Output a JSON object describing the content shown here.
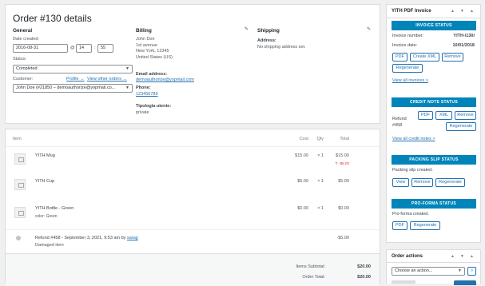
{
  "order": {
    "title": "Order #130 details",
    "general": {
      "heading": "General",
      "date_label": "Date created:",
      "date": "2016-08-31",
      "at": "@",
      "hour": "14",
      "colon": ":",
      "minute": "55",
      "status_label": "Status:",
      "status": "Completed",
      "customer_label": "Customer:",
      "profile_link": "Profile →",
      "other_orders_link": "View other orders →",
      "customer": "John Doe (#21850 – demoauthorize@yopmail.co..."
    },
    "billing": {
      "heading": "Billing",
      "address_lines": [
        "John Doe",
        "1st avenue",
        "New York, 12345",
        "United States (US)"
      ],
      "email_label": "Email address:",
      "email": "demoauthorize@yopmail.com",
      "phone_label": "Phone:",
      "phone": "123456789",
      "tipologia_label": "Tipologia utente:",
      "tipologia": "private"
    },
    "shipping": {
      "heading": "Shipping",
      "address_label": "Address:",
      "address": "No shipping address set."
    }
  },
  "items": {
    "headers": {
      "item": "Item",
      "cost": "Cost",
      "qty": "Qty",
      "total": "Total"
    },
    "rows": [
      {
        "name": "YITH Mug",
        "meta": "",
        "cost": "$15.00",
        "qty": "× 1",
        "total": "$15.00",
        "refund": "↰ -$6.00"
      },
      {
        "name": "YITH Cup",
        "meta": "",
        "cost": "$5.00",
        "qty": "× 1",
        "total": "$5.00",
        "refund": ""
      },
      {
        "name": "YITH Bottle - Green",
        "meta": "color: Green",
        "cost": "$0.00",
        "qty": "× 1",
        "total": "$0.00",
        "refund": ""
      }
    ],
    "refund_line": {
      "text": "Refund #458 - September 3, 2021, 9:53 am by",
      "by": "sarag",
      "note": "Damaged item",
      "amount": "-$5.00"
    },
    "totals": {
      "subtotal_label": "Items Subtotal:",
      "subtotal": "$20.00",
      "order_total_label": "Order Total:",
      "order_total": "$20.00"
    }
  },
  "pdf_box": {
    "title": "YITH PDF Invoice",
    "controls": [
      "▲",
      "▼",
      "▲"
    ],
    "invoice_status": "INVOICE STATUS",
    "invoice_number_label": "Invoice number:",
    "invoice_number": "YITH-/130/",
    "invoice_date_label": "Invoice date:",
    "invoice_date": "10/01/2018",
    "btn_pdf": "PDF",
    "btn_create_xml": "Create XML",
    "btn_remove": "Remove",
    "btn_regenerate": "Regenerate",
    "view_all_invoices": "View all invoices >",
    "credit_note_status": "CREDIT NOTE STATUS",
    "refund_label": "Refund",
    "refund_number": "#458",
    "cn_pdf": "PDF",
    "cn_xml": "XML",
    "cn_remove": "Remove",
    "cn_regenerate": "Regenerate",
    "view_all_credit_notes": "View all credit notes >",
    "packing_slip_status": "PACKING SLIP STATUS",
    "packing_created": "Packing slip created.",
    "ps_view": "View",
    "ps_remove": "Remove",
    "ps_regenerate": "Regenerate",
    "pro_forma_status": "PRO-FORMA STATUS",
    "pro_forma_created": "Pro-forma created.",
    "pf_pdf": "PDF",
    "pf_regenerate": "Regenerate"
  },
  "order_actions": {
    "title": "Order actions",
    "controls": [
      "▲",
      "▼",
      "▲"
    ],
    "choose": "Choose an action...",
    "go": ">"
  },
  "colors": {
    "accent": "#2271b1",
    "bar": "#0085ba",
    "refund": "#d63638"
  }
}
